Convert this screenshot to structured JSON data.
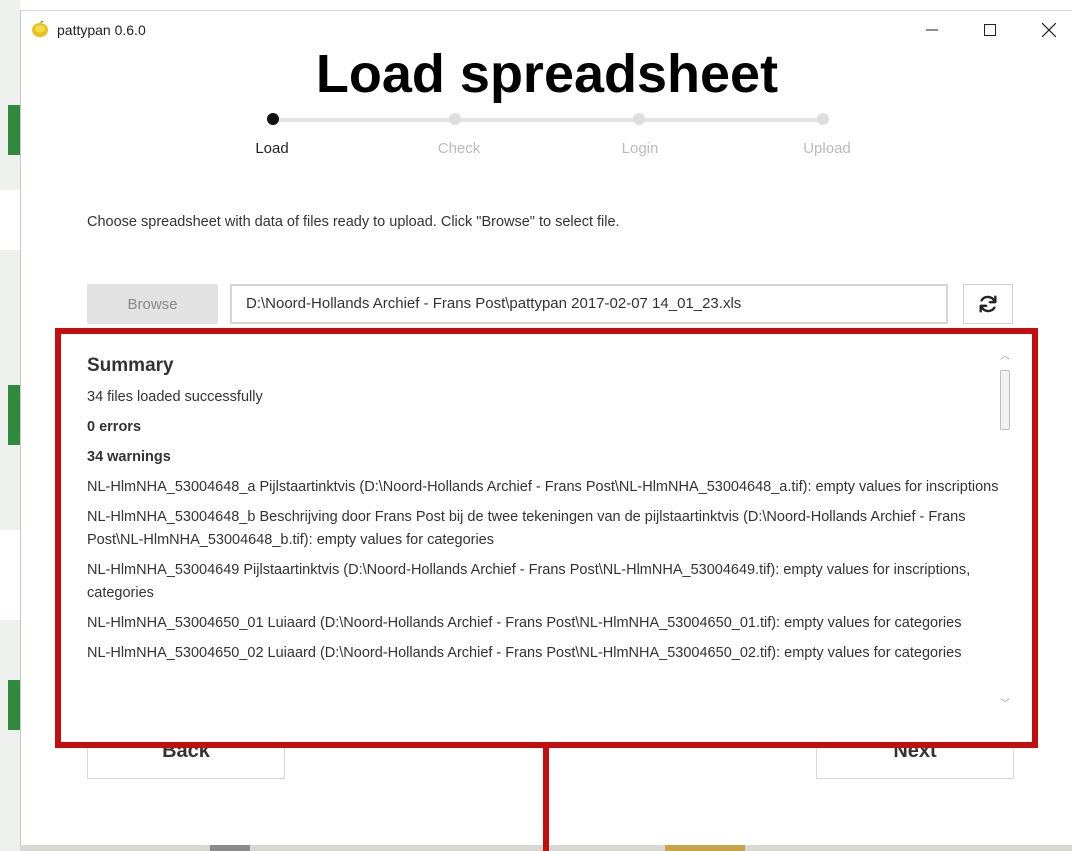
{
  "window": {
    "title": "pattypan 0.6.0"
  },
  "page": {
    "heading": "Load spreadsheet"
  },
  "stepper": {
    "steps": [
      {
        "label": "Load",
        "active": true
      },
      {
        "label": "Check",
        "active": false
      },
      {
        "label": "Login",
        "active": false
      },
      {
        "label": "Upload",
        "active": false
      }
    ]
  },
  "instruction": "Choose spreadsheet with data of files ready to upload. Click \"Browse\" to select file.",
  "browse": {
    "label": "Browse"
  },
  "file": {
    "path": "D:\\Noord-Hollands Archief - Frans Post\\pattypan 2017-02-07 14_01_23.xls"
  },
  "refresh": {
    "icon": "refresh-icon"
  },
  "summary": {
    "title": "Summary",
    "loaded": "34 files loaded successfully",
    "errors": "0 errors",
    "warnings": "34 warnings",
    "messages": [
      "NL-HlmNHA_53004648_a Pijlstaartinktvis (D:\\Noord-Hollands Archief - Frans Post\\NL-HlmNHA_53004648_a.tif): empty values for inscriptions",
      "NL-HlmNHA_53004648_b Beschrijving door Frans Post bij de twee tekeningen van de pijlstaartinktvis (D:\\Noord-Hollands Archief - Frans Post\\NL-HlmNHA_53004648_b.tif): empty values for categories",
      "NL-HlmNHA_53004649 Pijlstaartinktvis (D:\\Noord-Hollands Archief - Frans Post\\NL-HlmNHA_53004649.tif): empty values for inscriptions, categories",
      "NL-HlmNHA_53004650_01 Luiaard (D:\\Noord-Hollands Archief - Frans Post\\NL-HlmNHA_53004650_01.tif): empty values for categories",
      "NL-HlmNHA_53004650_02 Luiaard (D:\\Noord-Hollands Archief - Frans Post\\NL-HlmNHA_53004650_02.tif): empty values for categories"
    ]
  },
  "nav": {
    "back_label": "Back",
    "next_label": "Next"
  },
  "colors": {
    "highlight": "#c20e0e",
    "active_step": "#111111",
    "inactive_step": "#dedede"
  }
}
